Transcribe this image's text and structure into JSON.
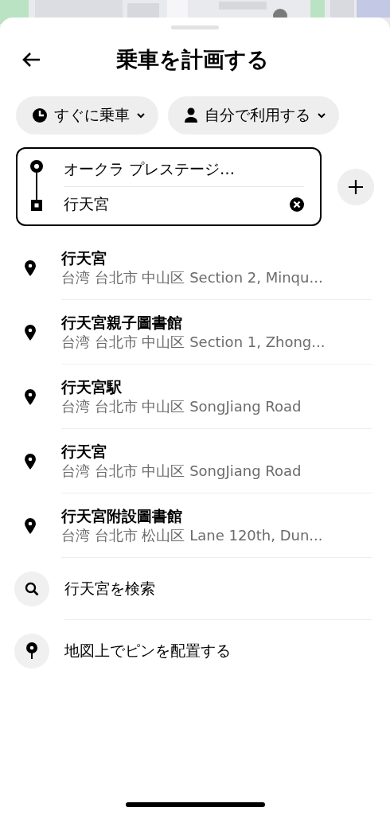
{
  "header": {
    "title": "乗車を計画する"
  },
  "chips": [
    {
      "kind": "clock",
      "label": "すぐに乗車"
    },
    {
      "kind": "person",
      "label": "自分で利用する"
    }
  ],
  "route": {
    "pickup": {
      "value": "オークラ プレステージ…"
    },
    "dropoff": {
      "value": "行天宮"
    }
  },
  "results": [
    {
      "name": "行天宮",
      "address": "台湾 台北市 中山区 Section 2, Minqu..."
    },
    {
      "name": "行天宮親子圖書館",
      "address": "台湾 台北市 中山区 Section 1, Zhong..."
    },
    {
      "name": "行天宮駅",
      "address": "台湾 台北市 中山区 SongJiang Road"
    },
    {
      "name": "行天宮",
      "address": "台湾 台北市 中山区 SongJiang Road"
    },
    {
      "name": "行天宮附設圖書館",
      "address": "台湾 台北市 松山区 Lane 120th, Dun..."
    }
  ],
  "actions": [
    {
      "kind": "search",
      "label": "行天宮を検索"
    },
    {
      "kind": "pin",
      "label": "地図上でピンを配置する"
    }
  ]
}
